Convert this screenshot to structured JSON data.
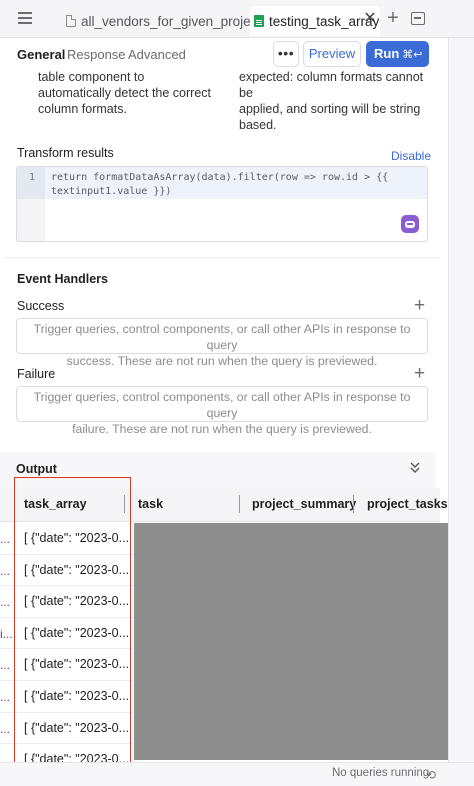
{
  "tabs": [
    {
      "label": "all_vendors_for_given_project",
      "icon": "js-file-icon"
    },
    {
      "label": "testing_task_array",
      "icon": "sheet-icon",
      "active": true
    }
  ],
  "subtabs": [
    "General",
    "Response",
    "Advanced"
  ],
  "toolbar": {
    "more": "•••",
    "preview": "Preview",
    "run": "Run",
    "run_shortcut": "⌘↩"
  },
  "description": {
    "left": [
      "table component to",
      "automatically detect the correct",
      "column formats."
    ],
    "right": [
      "expected: column formats cannot be",
      "applied, and sorting will be string",
      "based."
    ]
  },
  "transform": {
    "title": "Transform results",
    "disable": "Disable",
    "line_number": "1",
    "code_line1": "return formatDataAsArray(data).filter(row => row.id > {{",
    "code_line2": "textinput1.value }})"
  },
  "events": {
    "title": "Event Handlers",
    "success": {
      "label": "Success",
      "hint_1": "Trigger queries, control components, or call other APIs in response to query",
      "hint_2": "success. These are not run when the query is previewed."
    },
    "failure": {
      "label": "Failure",
      "hint_1": "Trigger queries, control components, or call other APIs in response to query",
      "hint_2": "failure. These are not run when the query is previewed."
    }
  },
  "output": {
    "title": "Output",
    "columns": [
      "task_array",
      "task",
      "project_summary",
      "project_tasks"
    ],
    "row_markers": [
      "...",
      "...",
      "...",
      "i...",
      "...",
      "...",
      "...",
      "..."
    ],
    "rows": [
      "[ {\"date\": \"2023-0...",
      "[ {\"date\": \"2023-0...",
      "[ {\"date\": \"2023-0...",
      "[ {\"date\": \"2023-0...",
      "[ {\"date\": \"2023-0...",
      "[ {\"date\": \"2023-0...",
      "[ {\"date\": \"2023-0...",
      "[ {\"date\": \"2023-0..."
    ]
  },
  "footer": {
    "status": "No queries running"
  }
}
